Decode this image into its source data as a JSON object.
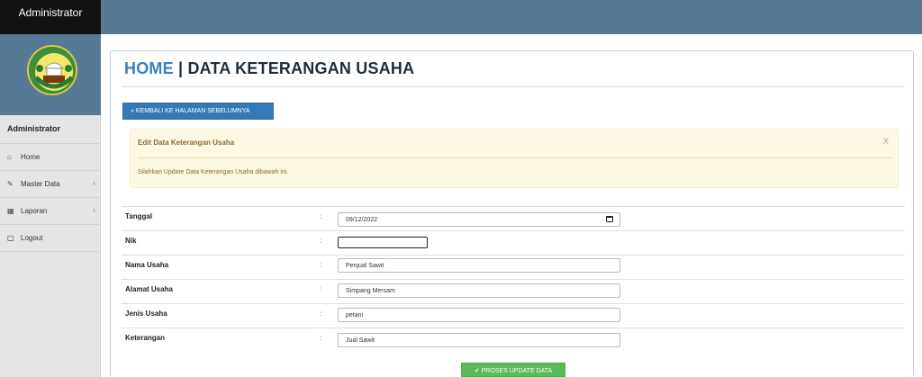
{
  "app": {
    "brand": "Administrator"
  },
  "sidebar": {
    "user": "Administrator",
    "items": [
      {
        "label": "Home",
        "icon": "home-icon",
        "has_submenu": false
      },
      {
        "label": "Master Data",
        "icon": "edit-icon",
        "has_submenu": true
      },
      {
        "label": "Laporan",
        "icon": "calendar-icon",
        "has_submenu": true
      },
      {
        "label": "Logout",
        "icon": "logout-icon",
        "has_submenu": false
      }
    ]
  },
  "header": {
    "home": "HOME",
    "separator": " | ",
    "title": "DATA KETERANGAN USAHA"
  },
  "back_button": {
    "label": "KEMBALI KE HALAMAN SEBELUMNYA",
    "icon": "double-chevron-left-icon"
  },
  "alert": {
    "title": "Edit Data Keterangan Usaha",
    "close": "X",
    "text": "Silahkan Update Data Keterangan Usaha dibawah ini."
  },
  "form": {
    "colon": ":",
    "fields": [
      {
        "label": "Tanggal",
        "value": "09/12/2022",
        "type": "date"
      },
      {
        "label": "Nik",
        "value": "",
        "type": "text"
      },
      {
        "label": "Nama Usaha",
        "value": "Penjual Sawit",
        "type": "text"
      },
      {
        "label": "Alamat Usaha",
        "value": "Simpang Mersam",
        "type": "text"
      },
      {
        "label": "Jenis Usaha",
        "value": "petani",
        "type": "text"
      },
      {
        "label": "Keterangan",
        "value": "Jual Sawit",
        "type": "text"
      }
    ]
  },
  "submit_button": {
    "label": "PROSES UPDATE DATA",
    "icon": "check-icon"
  },
  "colors": {
    "topbar": "#567a96",
    "primary": "#337ab7",
    "success": "#5cb85c",
    "alert_bg": "#fcf8e3"
  }
}
